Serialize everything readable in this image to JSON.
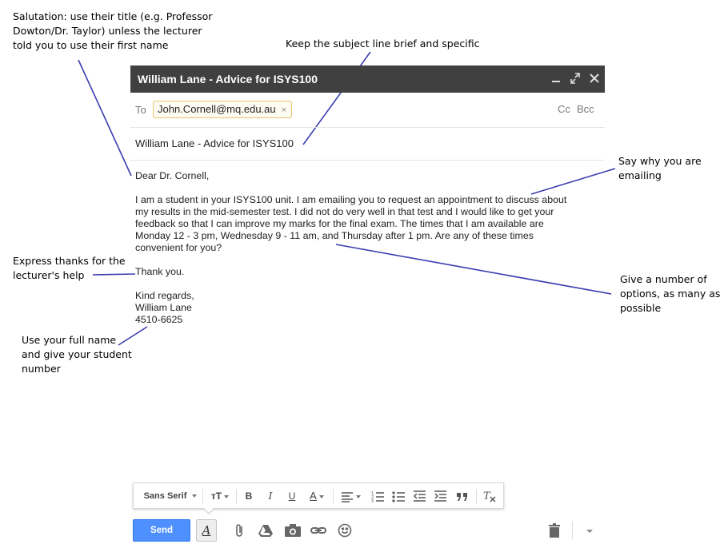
{
  "annotations": {
    "salutation": [
      "Salutation: use their title (e.g. Professor",
      "Dowton/Dr. Taylor) unless the lecturer",
      "told you to use their first name"
    ],
    "subject": "Keep the subject line brief and specific",
    "why": [
      "Say why you are",
      "emailing"
    ],
    "thanks": [
      "Express thanks for the",
      "lecturer's help"
    ],
    "options": [
      "Give a number of",
      "options, as many as",
      "possible"
    ],
    "fullname": [
      "Use your full name",
      "and give your student",
      "number"
    ]
  },
  "window": {
    "title": "William Lane - Advice for ISYS100",
    "minimize_icon": "minimize-icon",
    "expand_icon": "expand-icon",
    "close_icon": "close-icon"
  },
  "compose": {
    "to_label": "To",
    "recipient": "John.Cornell@mq.edu.au",
    "remove_symbol": "×",
    "cc_label": "Cc",
    "bcc_label": "Bcc",
    "subject": "William Lane - Advice for ISYS100"
  },
  "body": {
    "greeting": "Dear Dr. Cornell,",
    "paragraph": [
      "I am a student in your ISYS100 unit. I am emailing you to request an appointment to discuss about",
      "my results in the mid-semester test. I did not do very well in that test and I would like to get your",
      "feedback so that I can improve my marks for the final exam. The times that I am available are",
      "Monday 12 - 3 pm, Wednesday 9 - 11 am, and Thursday after 1 pm. Are any of these times",
      "convenient for you?"
    ],
    "thanks": "Thank you.",
    "signoff": "Kind regards,",
    "name": "William Lane",
    "student_number": "4510-6625"
  },
  "toolbar": {
    "font_family": "Sans Serif",
    "size_glyph": "тT",
    "bold": "B",
    "italic": "I",
    "underline": "U",
    "text_color": "A",
    "send_label": "Send",
    "format_toggle": "A"
  },
  "colors": {
    "annotation_line": "#3a3db0",
    "titlebar": "#404040",
    "send_button": "#4d90fe"
  }
}
